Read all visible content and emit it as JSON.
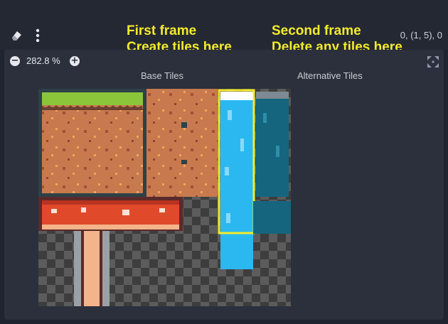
{
  "coords": "0, (1, 5), 0",
  "zoom": {
    "level": "282.8 %"
  },
  "labels": {
    "base_tiles": "Base Tiles",
    "alternative_tiles": "Alternative Tiles"
  },
  "annotations": {
    "first_line1": "First frame",
    "first_line2": "Create tiles here",
    "second_line1": "Second frame",
    "second_line2": "Delete any tiles here"
  },
  "colors": {
    "annotation": "#f5ec28",
    "panel_bg": "#2b303c",
    "water": "#2bb8f0",
    "water_alt": "#15657f",
    "dirt": "#c87a4e",
    "grass": "#8bc63a",
    "mushroom": "#e04a2a"
  },
  "icons": [
    "eraser-icon",
    "kebab-menu-icon",
    "zoom-out-icon",
    "zoom-in-icon",
    "center-view-icon",
    "arrow-icon"
  ]
}
